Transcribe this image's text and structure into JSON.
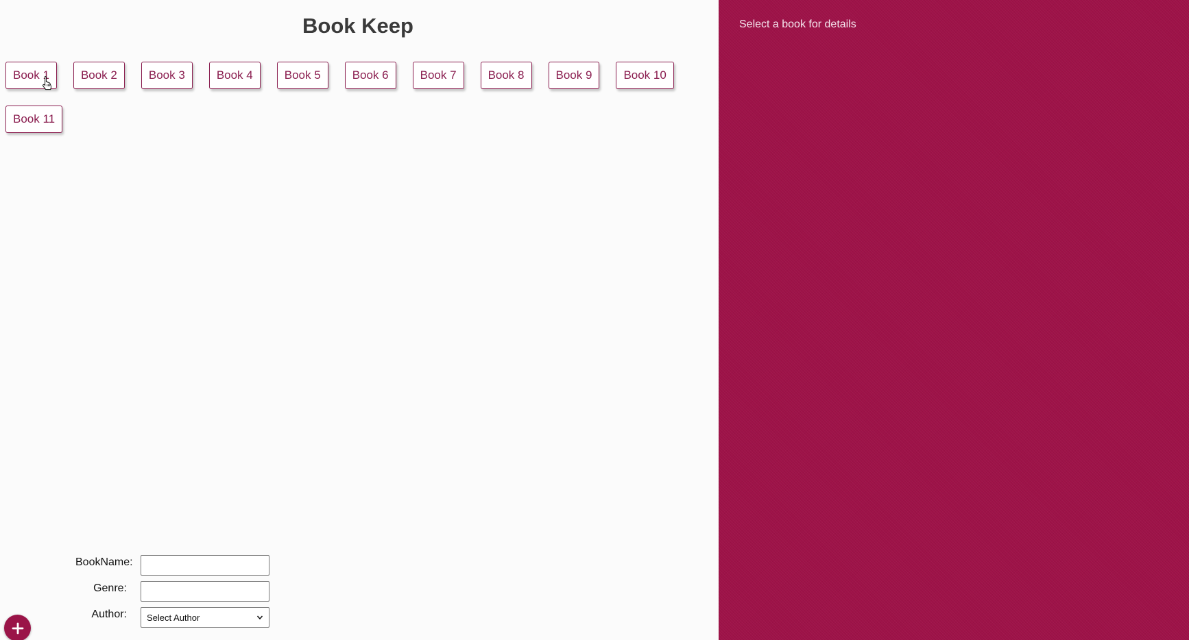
{
  "app": {
    "title": "Book Keep"
  },
  "books": [
    {
      "label": "Book 1"
    },
    {
      "label": "Book 2"
    },
    {
      "label": "Book 3"
    },
    {
      "label": "Book 4"
    },
    {
      "label": "Book 5"
    },
    {
      "label": "Book 6"
    },
    {
      "label": "Book 7"
    },
    {
      "label": "Book 8"
    },
    {
      "label": "Book 9"
    },
    {
      "label": "Book 10"
    },
    {
      "label": "Book 11"
    }
  ],
  "form": {
    "book_name_label": "BookName:",
    "book_name_value": "",
    "genre_label": "Genre:",
    "genre_value": "",
    "author_label": "Author:",
    "author_selected": "Select Author"
  },
  "details": {
    "placeholder": "Select a book for details"
  },
  "icons": {
    "add": "plus-icon",
    "cursor": "hand-pointer-icon",
    "select": "chevron-down-icon"
  },
  "colors": {
    "accent": "#9e1248",
    "button_text": "#8a1d4f",
    "title": "#3a3a3a"
  }
}
